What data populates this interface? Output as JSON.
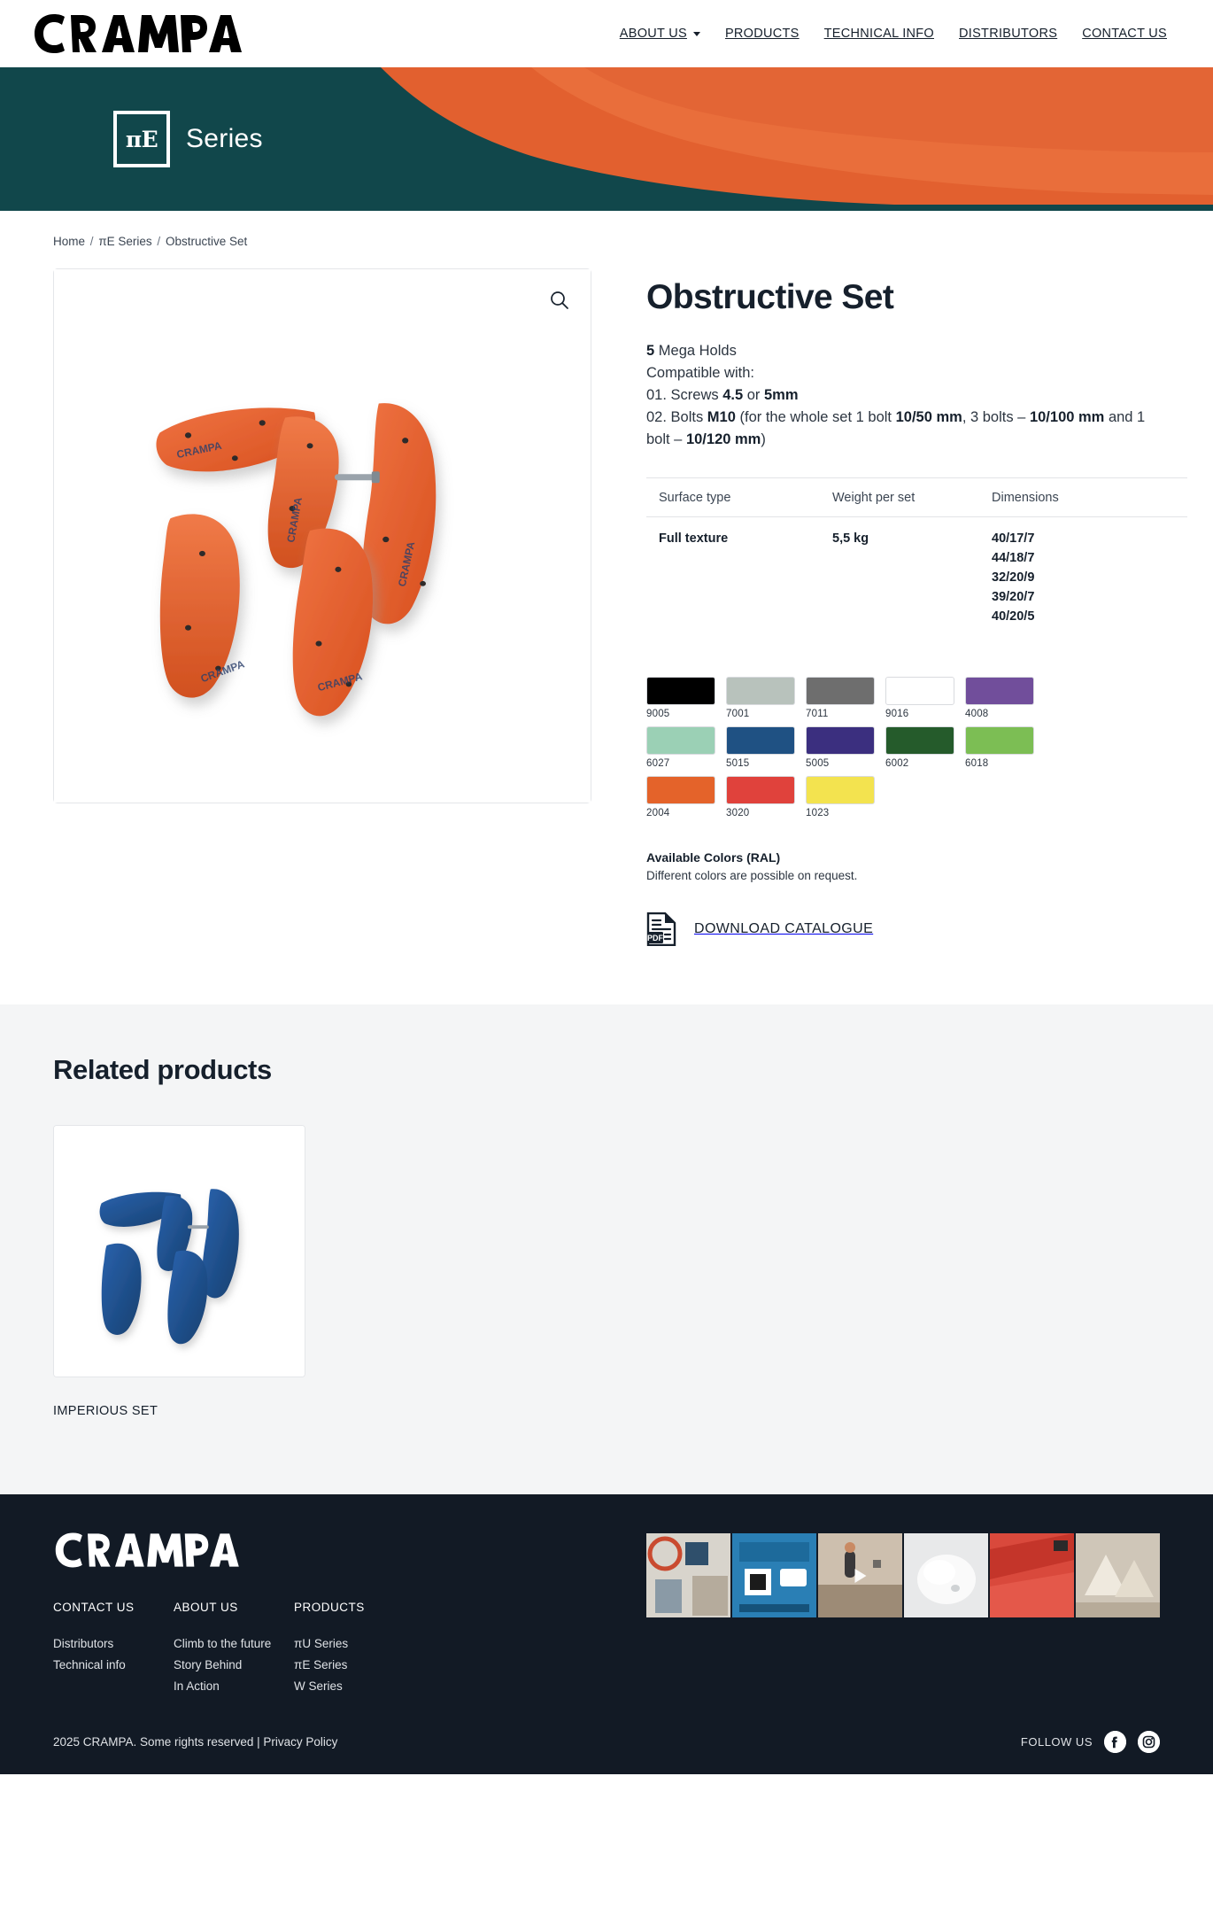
{
  "header": {
    "logo_text": "CRAMPA",
    "nav": [
      {
        "label": "ABOUT US",
        "has_dropdown": true
      },
      {
        "label": "PRODUCTS",
        "has_dropdown": false
      },
      {
        "label": "TECHNICAL INFO",
        "has_dropdown": false
      },
      {
        "label": "DISTRIBUTORS",
        "has_dropdown": false
      },
      {
        "label": "CONTACT US",
        "has_dropdown": false
      }
    ]
  },
  "hero": {
    "badge_text": "πE",
    "series_label": "Series",
    "bg_color": "#11474b",
    "hold_color": "#e2602f"
  },
  "breadcrumb": {
    "home": "Home",
    "series": "πE Series",
    "current": "Obstructive Set",
    "separator": "/"
  },
  "product": {
    "title": "Obstructive Set",
    "zoom_icon": "search-icon",
    "description": {
      "line1_bold": "5",
      "line1_rest": " Mega Holds",
      "line2": "Compatible with:",
      "line3_prefix": "01. Screws ",
      "line3_b1": "4.5",
      "line3_mid": " or ",
      "line3_b2": "5mm",
      "line4_prefix": "02. Bolts ",
      "line4_b1": "M10",
      "line4_mid1": " (for the whole set 1 bolt ",
      "line4_b2": "10/50 mm",
      "line4_mid2": ", 3 bolts – ",
      "line4_b3": "10/100 mm",
      "line4_mid3": " and 1 bolt – ",
      "line4_b4": "10/120 mm",
      "line4_suffix": ")"
    },
    "spec_table": {
      "headers": [
        "Surface type",
        "Weight per set",
        "Dimensions"
      ],
      "rows": [
        {
          "surface": "Full texture",
          "weight": "5,5 kg",
          "dimensions": "40/17/7\n44/18/7\n32/20/9\n39/20/7\n40/20/5"
        }
      ]
    },
    "colors": {
      "heading": "Available Colors (RAL)",
      "note": "Different colors are possible on request.",
      "swatches": [
        {
          "code": "9005",
          "hex": "#000000"
        },
        {
          "code": "7001",
          "hex": "#b8c2bc"
        },
        {
          "code": "7011",
          "hex": "#6e6e6e"
        },
        {
          "code": "9016",
          "hex": "#ffffff"
        },
        {
          "code": "4008",
          "hex": "#714e9b"
        },
        {
          "code": "6027",
          "hex": "#9bd0b5"
        },
        {
          "code": "5015",
          "hex": "#1f5183"
        },
        {
          "code": "5005",
          "hex": "#3b2f7f"
        },
        {
          "code": "6002",
          "hex": "#255b2b"
        },
        {
          "code": "6018",
          "hex": "#7cbe54"
        },
        {
          "code": "2004",
          "hex": "#e4632a"
        },
        {
          "code": "3020",
          "hex": "#e0423c"
        },
        {
          "code": "1023",
          "hex": "#f3e martin"
        }
      ]
    },
    "download": {
      "label": "DOWNLOAD CATALOGUE",
      "icon": "pdf-file-icon"
    }
  },
  "related": {
    "heading": "Related products",
    "items": [
      {
        "name": "IMPERIOUS SET",
        "color": "#1d4f92"
      }
    ]
  },
  "footer": {
    "logo_text": "CRAMPA",
    "columns": [
      {
        "title": "CONTACT US",
        "links": [
          "Distributors",
          "Technical info"
        ]
      },
      {
        "title": "ABOUT US",
        "links": [
          "Climb to the future",
          "Story Behind",
          "In Action"
        ]
      },
      {
        "title": "PRODUCTS",
        "links": [
          "πU Series",
          "πE Series",
          "W Series"
        ]
      }
    ],
    "instagram_tiles": [
      {
        "name": "gym-wall-tile",
        "has_play": false
      },
      {
        "name": "website-announcement-tile",
        "has_play": false
      },
      {
        "name": "climber-video-tile",
        "has_play": true
      },
      {
        "name": "white-hold-video-tile",
        "has_play": true
      },
      {
        "name": "red-volume-tile",
        "has_play": false
      },
      {
        "name": "logo-texture-tile",
        "has_play": false
      }
    ],
    "copyright": "2025 CRAMPA. Some rights reserved",
    "copyright_sep": "|",
    "privacy": "Privacy Policy",
    "follow_label": "FOLLOW US",
    "social": [
      {
        "name": "facebook-icon"
      },
      {
        "name": "instagram-icon"
      }
    ]
  }
}
